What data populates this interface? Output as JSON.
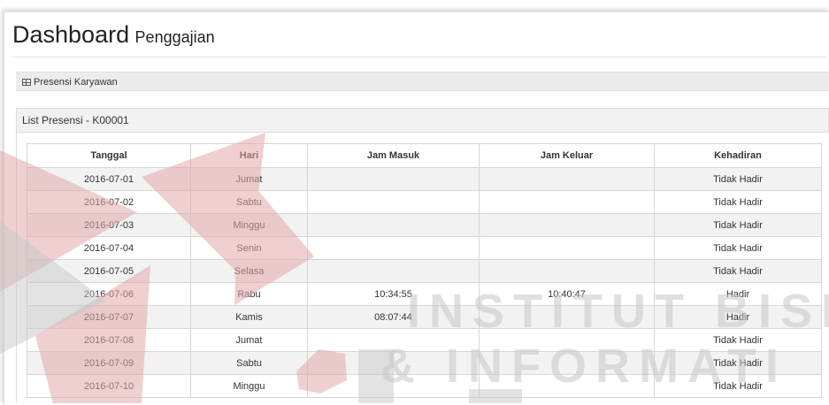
{
  "header": {
    "title": "Dashboard",
    "subtitle": "Penggajian"
  },
  "breadcrumb": {
    "icon": "table-icon",
    "label": "Presensi Karyawan"
  },
  "panel": {
    "heading": "List Presensi - K00001"
  },
  "table": {
    "columns": [
      "Tanggal",
      "Hari",
      "Jam Masuk",
      "Jam Keluar",
      "Kehadiran"
    ],
    "rows": [
      [
        "2016-07-01",
        "Jumat",
        "",
        "",
        "Tidak Hadir"
      ],
      [
        "2016-07-02",
        "Sabtu",
        "",
        "",
        "Tidak Hadir"
      ],
      [
        "2016-07-03",
        "Minggu",
        "",
        "",
        "Tidak Hadir"
      ],
      [
        "2016-07-04",
        "Senin",
        "",
        "",
        "Tidak Hadir"
      ],
      [
        "2016-07-05",
        "Selasa",
        "",
        "",
        "Tidak Hadir"
      ],
      [
        "2016-07-06",
        "Rabu",
        "10:34:55",
        "10:40:47",
        "Hadir"
      ],
      [
        "2016-07-07",
        "Kamis",
        "08:07:44",
        "",
        "Hadir"
      ],
      [
        "2016-07-08",
        "Jumat",
        "",
        "",
        "Tidak Hadir"
      ],
      [
        "2016-07-09",
        "Sabtu",
        "",
        "",
        "Tidak Hadir"
      ],
      [
        "2016-07-10",
        "Minggu",
        "",
        "",
        "Tidak Hadir"
      ]
    ]
  },
  "watermark": {
    "line1": "INSTITUT BISN",
    "line2": "& INFORMATI"
  },
  "colors": {
    "watermark_red": "#e2a9aa",
    "watermark_gray": "#c8c8c8"
  }
}
